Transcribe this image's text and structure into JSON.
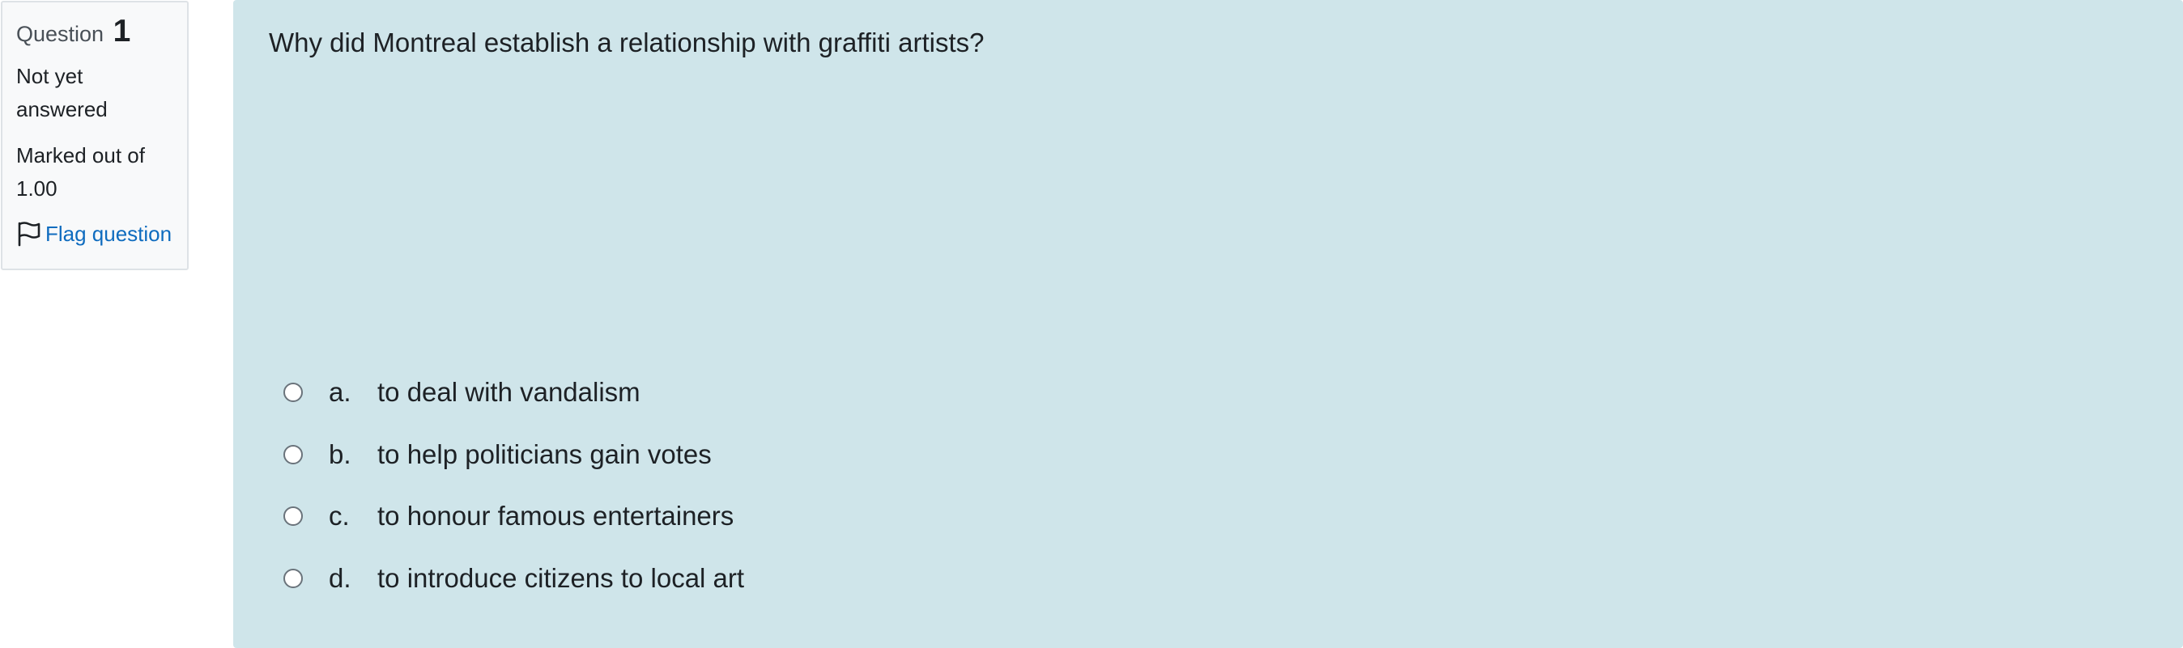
{
  "info": {
    "question_word": "Question",
    "question_number": "1",
    "state": "Not yet answered",
    "grade": "Marked out of 1.00",
    "flag_label": "Flag question",
    "flag_icon": "flag-outline-icon"
  },
  "question": {
    "text": "Why did Montreal establish a relationship with graffiti artists?",
    "answers": [
      {
        "letter": "a.",
        "text": "to deal with vandalism"
      },
      {
        "letter": "b.",
        "text": "to help politicians gain votes"
      },
      {
        "letter": "c.",
        "text": "to honour famous entertainers"
      },
      {
        "letter": "d.",
        "text": "to introduce citizens to local art"
      }
    ]
  },
  "colors": {
    "content_bg": "#cfe5ea",
    "info_bg": "#f8f9fa",
    "link": "#0f6cbf"
  }
}
